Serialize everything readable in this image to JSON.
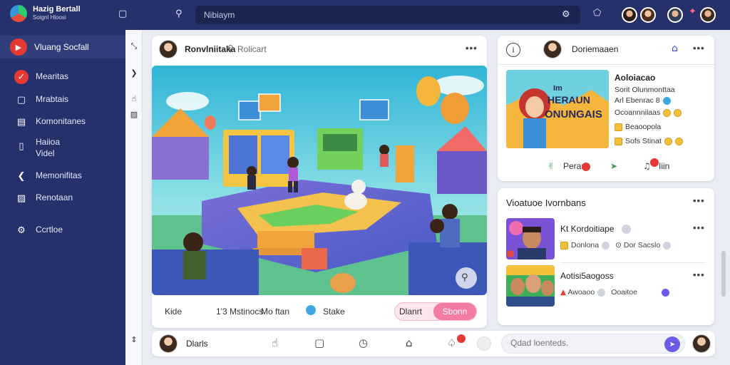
{
  "app": {
    "title": "Hazig Bertall",
    "subtitle": "Soignl Hloosi"
  },
  "topbar": {
    "search_value": "Nibiaym",
    "icons": [
      "square-icon",
      "search-icon",
      "gear-icon",
      "chat-icon"
    ]
  },
  "sidebar": {
    "primary": {
      "label": "Vluang Socfall",
      "icon": "bolt-icon"
    },
    "items": [
      {
        "label": "Mearitas",
        "icon": "check-icon"
      },
      {
        "label": "Mrabtais",
        "icon": "square-icon"
      },
      {
        "label": "Komonitanes",
        "icon": "list-icon"
      },
      {
        "label": "Haiioa\nVidel",
        "icon": "phone-icon"
      },
      {
        "label": "Memonifitas",
        "icon": "chevron-icon"
      },
      {
        "label": "Renotaan",
        "icon": "image-icon"
      },
      {
        "label": "Ccrtloe",
        "icon": "gear-icon"
      }
    ]
  },
  "post": {
    "author": "Ronvlniitaka",
    "tag": "Rolicart",
    "actions": {
      "like": "Kide",
      "count": "1'3 Mstinocs",
      "more": "Mo ftan",
      "share": "Stake"
    },
    "toggle": {
      "left": "Dlanrt",
      "right": "Sbonn"
    }
  },
  "bottombar": {
    "user": "Dlarls",
    "comment_placeholder": "Qdad loenteds."
  },
  "right_card": {
    "title": "Doriemaaen",
    "thumb_line1": "Im",
    "thumb_line2": "HERAUN",
    "thumb_line3": "ONUNGAIS",
    "heading": "Aoloiacao",
    "lines": [
      "Sorit Olunmonttaa",
      "Arl Ebenrac 8",
      "Ocoannnilaas",
      "Beaoopola",
      "Sofs Stinat"
    ],
    "actions": {
      "a": "Perarb",
      "b": "Iiin"
    }
  },
  "friends_card": {
    "title": "Vioatuoe Ivornbans",
    "rows": [
      {
        "name": "Kt Kordoitiape",
        "meta1": "Donlona",
        "meta2": "Dor Sacslo"
      },
      {
        "name": "Aotisi5aogoss",
        "meta1": "Awoaoo",
        "meta2": "Ooaitoe"
      }
    ]
  },
  "colors": {
    "topbar": "#26306a",
    "accent": "#e53935",
    "pill": "#f47ba6",
    "send": "#6b5ce7"
  }
}
